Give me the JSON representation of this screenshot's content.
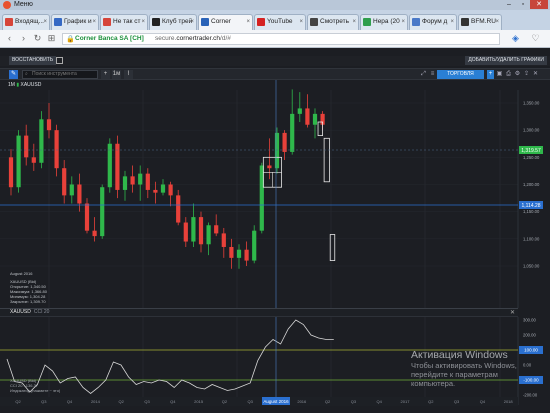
{
  "window": {
    "title": "Меню",
    "min": "–",
    "max": "▫",
    "close": "✕"
  },
  "tabs": [
    {
      "label": "Входящ...",
      "color": "#d6453a"
    },
    {
      "label": "График и",
      "color": "#3569c4"
    },
    {
      "label": "Не так ст",
      "color": "#d6453a"
    },
    {
      "label": "Клуб трей",
      "color": "#222222"
    },
    {
      "label": "Corner",
      "color": "#2a63b8"
    },
    {
      "label": "YouTube",
      "color": "#d52222"
    },
    {
      "label": "Смотреть",
      "color": "#444444"
    },
    {
      "label": "Нера (20",
      "color": "#2f9e4c"
    },
    {
      "label": "Форум д",
      "color": "#4a79c8"
    },
    {
      "label": "BFM.RU",
      "color": "#333333"
    }
  ],
  "address": {
    "org": "Corner Banca SA [CH]",
    "host": "secure.",
    "host_bold": "cornertrader.ch",
    "path": "/d/#"
  },
  "platform": {
    "restore_label": "ВОССТАНОВИТЬ",
    "add_remove_label": "ДОБАВИТЬ/УДАЛИТЬ ГРАФИКИ",
    "search_placeholder": "Поиск инструмента",
    "trade_label": "ТОРГОВЛЯ",
    "period": "1М",
    "symbol": "XAUUSD",
    "plus": "+",
    "period_btn": "1м"
  },
  "legend": {
    "date": "August 2016",
    "symbol_line": "XAUUSD (Bid)",
    "open": "Открытие: 1,340.50",
    "high": "Максимум: 1,366.80",
    "low": "Минимум: 1,304.28",
    "close": "Закрытие: 1,309.70",
    "osc_symbol": "XAUUSD (Bid)",
    "osc_value": "CCI 20 : 136.37"
  },
  "osc": {
    "title": "XAUUSD",
    "subtitle": "CCI 20",
    "close": "✕",
    "bottom_label": "Индикатор (нажмите ~ это)"
  },
  "watermark": {
    "title": "Активация Windows",
    "line1": "Чтобы активировать Windows,",
    "line2": "перейдите к параметрам",
    "line3": "компьютера."
  },
  "chart_data": {
    "type": "candlestick",
    "price_axis": {
      "ticks": [
        "1,350.00",
        "1,300.00",
        "1,250.00",
        "1,200.00",
        "1,150.00",
        "1,100.00",
        "1,050.00"
      ],
      "current_price": "1,319.57",
      "current_color": "#2fb84b",
      "marker_price": "1,114.28",
      "marker_color": "#2a6fcf"
    },
    "osc_axis": {
      "ticks": [
        "300.00",
        "200.00",
        "100.00",
        "0.00",
        "-100.00",
        "-200.00"
      ],
      "upper_level": "100.00",
      "lower_level": "-100.00"
    },
    "time_axis": [
      "Q2",
      "Q3",
      "Q4",
      "2014",
      "Q2",
      "Q3",
      "Q4",
      "2015",
      "Q2",
      "Q3",
      "Q4",
      "2016",
      "Q2",
      "Q3",
      "Q4",
      "2017",
      "Q2",
      "Q3",
      "Q4",
      "2018"
    ],
    "selected_time": "August 2016",
    "candles": [
      {
        "o": 1250,
        "c": 1195,
        "h": 1265,
        "l": 1180
      },
      {
        "o": 1195,
        "c": 1290,
        "h": 1300,
        "l": 1185
      },
      {
        "o": 1290,
        "c": 1250,
        "h": 1310,
        "l": 1235
      },
      {
        "o": 1250,
        "c": 1240,
        "h": 1275,
        "l": 1225
      },
      {
        "o": 1240,
        "c": 1320,
        "h": 1335,
        "l": 1230
      },
      {
        "o": 1320,
        "c": 1300,
        "h": 1350,
        "l": 1285
      },
      {
        "o": 1300,
        "c": 1230,
        "h": 1310,
        "l": 1215
      },
      {
        "o": 1230,
        "c": 1180,
        "h": 1245,
        "l": 1165
      },
      {
        "o": 1180,
        "c": 1200,
        "h": 1215,
        "l": 1165
      },
      {
        "o": 1200,
        "c": 1165,
        "h": 1220,
        "l": 1150
      },
      {
        "o": 1165,
        "c": 1115,
        "h": 1175,
        "l": 1110
      },
      {
        "o": 1115,
        "c": 1105,
        "h": 1140,
        "l": 1095
      },
      {
        "o": 1105,
        "c": 1195,
        "h": 1200,
        "l": 1100
      },
      {
        "o": 1195,
        "c": 1275,
        "h": 1285,
        "l": 1185
      },
      {
        "o": 1275,
        "c": 1190,
        "h": 1290,
        "l": 1175
      },
      {
        "o": 1190,
        "c": 1215,
        "h": 1225,
        "l": 1170
      },
      {
        "o": 1215,
        "c": 1200,
        "h": 1235,
        "l": 1185
      },
      {
        "o": 1200,
        "c": 1220,
        "h": 1235,
        "l": 1170
      },
      {
        "o": 1220,
        "c": 1190,
        "h": 1230,
        "l": 1175
      },
      {
        "o": 1190,
        "c": 1185,
        "h": 1205,
        "l": 1165
      },
      {
        "o": 1185,
        "c": 1200,
        "h": 1210,
        "l": 1180
      },
      {
        "o": 1200,
        "c": 1180,
        "h": 1205,
        "l": 1160
      },
      {
        "o": 1180,
        "c": 1130,
        "h": 1190,
        "l": 1125
      },
      {
        "o": 1130,
        "c": 1095,
        "h": 1140,
        "l": 1085
      },
      {
        "o": 1095,
        "c": 1140,
        "h": 1165,
        "l": 1085
      },
      {
        "o": 1140,
        "c": 1090,
        "h": 1150,
        "l": 1075
      },
      {
        "o": 1090,
        "c": 1125,
        "h": 1130,
        "l": 1070
      },
      {
        "o": 1125,
        "c": 1110,
        "h": 1145,
        "l": 1105
      },
      {
        "o": 1110,
        "c": 1085,
        "h": 1120,
        "l": 1065
      },
      {
        "o": 1085,
        "c": 1065,
        "h": 1100,
        "l": 1045
      },
      {
        "o": 1065,
        "c": 1080,
        "h": 1090,
        "l": 1045
      },
      {
        "o": 1080,
        "c": 1060,
        "h": 1095,
        "l": 1050
      },
      {
        "o": 1060,
        "c": 1115,
        "h": 1125,
        "l": 1055
      },
      {
        "o": 1115,
        "c": 1235,
        "h": 1240,
        "l": 1110
      },
      {
        "o": 1235,
        "c": 1230,
        "h": 1285,
        "l": 1210
      },
      {
        "o": 1230,
        "c": 1295,
        "h": 1305,
        "l": 1220
      },
      {
        "o": 1295,
        "c": 1260,
        "h": 1300,
        "l": 1245
      },
      {
        "o": 1260,
        "c": 1330,
        "h": 1375,
        "l": 1255
      },
      {
        "o": 1330,
        "c": 1340,
        "h": 1370,
        "l": 1315
      },
      {
        "o": 1340,
        "c": 1310,
        "h": 1366,
        "l": 1305
      },
      {
        "o": 1310,
        "c": 1330,
        "h": 1340,
        "l": 1285
      },
      {
        "o": 1330,
        "c": 1310,
        "h": 1335,
        "l": 1300
      }
    ],
    "projection_boxes": [
      {
        "x0": 40.4,
        "x1": 41.0,
        "p0": 1290,
        "p1": 1315
      },
      {
        "x0": 41.2,
        "x1": 41.9,
        "p0": 1205,
        "p1": 1285
      },
      {
        "x0": 42.0,
        "x1": 42.6,
        "p0": 1060,
        "p1": 1108
      },
      {
        "x0": 33.2,
        "x1": 35.6,
        "p0": 1195,
        "p1": 1250
      }
    ],
    "cci": [
      40,
      -110,
      -120,
      -180,
      -130,
      0,
      -40,
      -120,
      -90,
      -80,
      -150,
      -190,
      -150,
      -100,
      20,
      0,
      -80,
      -130,
      -110,
      -120,
      -100,
      -110,
      -150,
      -100,
      -120,
      -150,
      -160,
      -130,
      -150,
      -170,
      -160,
      -140,
      -120,
      30,
      120,
      170,
      140,
      240,
      300,
      270,
      200,
      180,
      170,
      170
    ]
  }
}
